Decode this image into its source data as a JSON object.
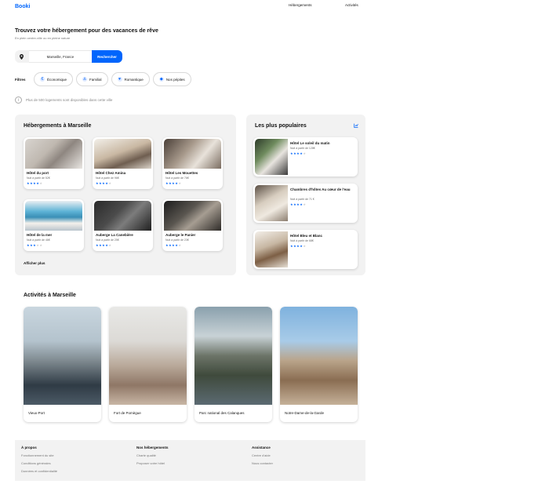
{
  "header": {
    "logo": "Booki",
    "nav": [
      "Hébergements",
      "Activités"
    ]
  },
  "hero": {
    "title": "Trouvez votre hébergement pour des vacances de rêve",
    "subtitle": "En plein centre-ville ou en pleine nature"
  },
  "search": {
    "icon": "location-pin-icon",
    "value": "Marseille, France",
    "button": "Rechercher"
  },
  "filters": {
    "label": "Filtres",
    "items": [
      {
        "label": "Économique",
        "icon": "money-icon"
      },
      {
        "label": "Familial",
        "icon": "child-icon"
      },
      {
        "label": "Romantique",
        "icon": "heart-icon"
      },
      {
        "label": "Nos pépites",
        "icon": "gem-icon"
      }
    ]
  },
  "info": {
    "icon": "info-icon",
    "text": "Plus de 500 logements sont disponibles dans cette ville"
  },
  "hebergements": {
    "title": "Hébergements à Marseille",
    "more": "Afficher plus",
    "cards": [
      {
        "name": "Hôtel du port",
        "price": "Nuit à partir de 52€",
        "rating": 4
      },
      {
        "name": "Hôtel Chez Amina",
        "price": "Nuit à partir de 96€",
        "rating": 4
      },
      {
        "name": "Hôtel Les Mouettes",
        "price": "Nuit à partir de 76€",
        "rating": 4
      },
      {
        "name": "Hôtel de la mer",
        "price": "Nuit à partir de 46€",
        "rating": 3
      },
      {
        "name": "Auberge La Canebière",
        "price": "Nuit à partir de 25€",
        "rating": 4
      },
      {
        "name": "Auberge le Panier",
        "price": "Nuit à partir de 23€",
        "rating": 4
      }
    ]
  },
  "populaires": {
    "title": "Les plus populaires",
    "icon": "chart-icon",
    "cards": [
      {
        "name": "Hôtel Le soleil du matin",
        "price": "Nuit à partir de 128€",
        "rating": 4
      },
      {
        "name": "Chambres d'hôtes Au cœur de l'eau",
        "price": "Nuit à partir de 71 €",
        "rating": 4
      },
      {
        "name": "Hôtel Bleu et Blanc",
        "price": "Nuit à partir de 68€",
        "rating": 4
      }
    ]
  },
  "activites": {
    "title": "Activités à Marseille",
    "cards": [
      "Vieux-Port",
      "Fort de Pomègue",
      "Parc national des Calanques",
      "Notre-Dame-de-la-Garde"
    ]
  },
  "footer": {
    "cols": [
      {
        "title": "À propos",
        "links": [
          "Fonctionnement du site",
          "Conditions générales",
          "Données et confidentialité"
        ]
      },
      {
        "title": "Nos hébergements",
        "links": [
          "Charte qualité",
          "Proposer votre hôtel"
        ]
      },
      {
        "title": "Assistance",
        "links": [
          "Centre d'aide",
          "Nous contacter"
        ]
      }
    ]
  },
  "colors": {
    "brand": "#0065fc",
    "panel": "#f2f2f2"
  }
}
